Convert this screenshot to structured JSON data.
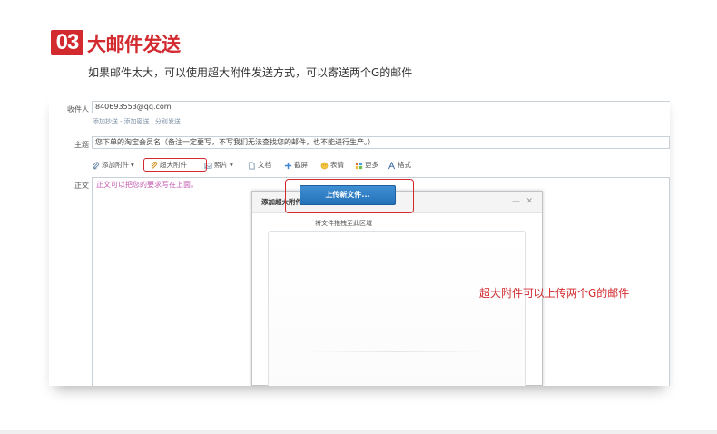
{
  "step": {
    "number": "03",
    "title": "大邮件发送",
    "subtitle": "如果邮件太大，可以使用超大附件发送方式，可以寄送两个G的邮件"
  },
  "compose": {
    "recipient_label": "收件人",
    "recipient_value": "840693553@qq.com",
    "recipient_links": [
      "添加抄送",
      "-",
      "添加密送",
      "|",
      "分别发送"
    ],
    "subject_label": "主题",
    "subject_value": "您下单的淘宝会员名（备注一定要写，不写我们无法查找您的邮件，也不能进行生产。）",
    "body_label": "正文",
    "body_text": "正文可以把您的要求写在上面。",
    "toolbar": {
      "attach": "添加附件",
      "attach_caret": "▾",
      "big_attach": "超大附件",
      "photo": "照片",
      "photo_caret": "▾",
      "doc": "文档",
      "screenshot": "截屏",
      "emoji": "表情",
      "more": "更多",
      "format": "格式"
    }
  },
  "dialog": {
    "title": "添加超大附件",
    "minimize": "—",
    "close": "✕",
    "upload_button": "上传新文件...",
    "drop_hint": "将文件拖拽至此区域"
  },
  "annotation": "超大附件可以上传两个G的邮件",
  "colors": {
    "accent_red": "#d22a2f",
    "button_blue": "#2f7fc6",
    "body_text_pink": "#c45bb0",
    "link_gray_blue": "#7a8fa6"
  }
}
